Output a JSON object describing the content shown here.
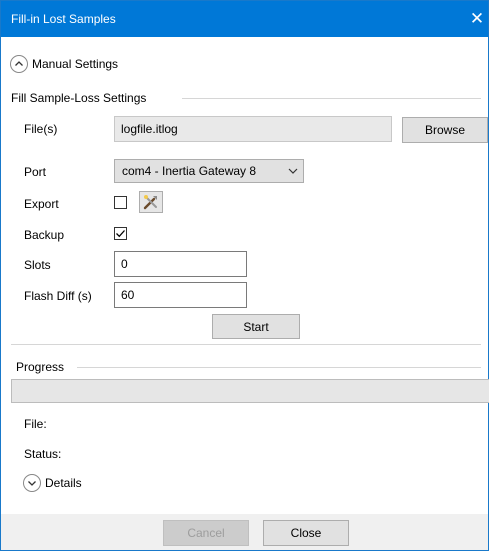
{
  "window": {
    "title": "Fill-in Lost Samples",
    "close_glyph": "✕"
  },
  "manual_settings": {
    "label": "Manual Settings",
    "icon": "chevron-up-icon"
  },
  "fill_settings": {
    "group_label": "Fill Sample-Loss Settings",
    "file_label": "File(s)",
    "file_value": "logfile.itlog",
    "browse_label": "Browse",
    "port_label": "Port",
    "port_value": "com4 - Inertia Gateway 8",
    "export_label": "Export",
    "export_checked": false,
    "export_tool_icon": "tools-icon",
    "backup_label": "Backup",
    "backup_checked": true,
    "slots_label": "Slots",
    "slots_value": "0",
    "flash_diff_label": "Flash Diff (s)",
    "flash_diff_value": "60",
    "start_label": "Start"
  },
  "progress": {
    "group_label": "Progress",
    "value": 0,
    "file_label": "File:",
    "status_label": "Status:"
  },
  "details": {
    "label": "Details",
    "icon": "chevron-down-icon"
  },
  "footer": {
    "cancel_label": "Cancel",
    "close_label": "Close"
  },
  "colors": {
    "titlebar": "#0078d7",
    "window_bg": "#ffffff",
    "footer_bg": "#f0f0f0"
  }
}
